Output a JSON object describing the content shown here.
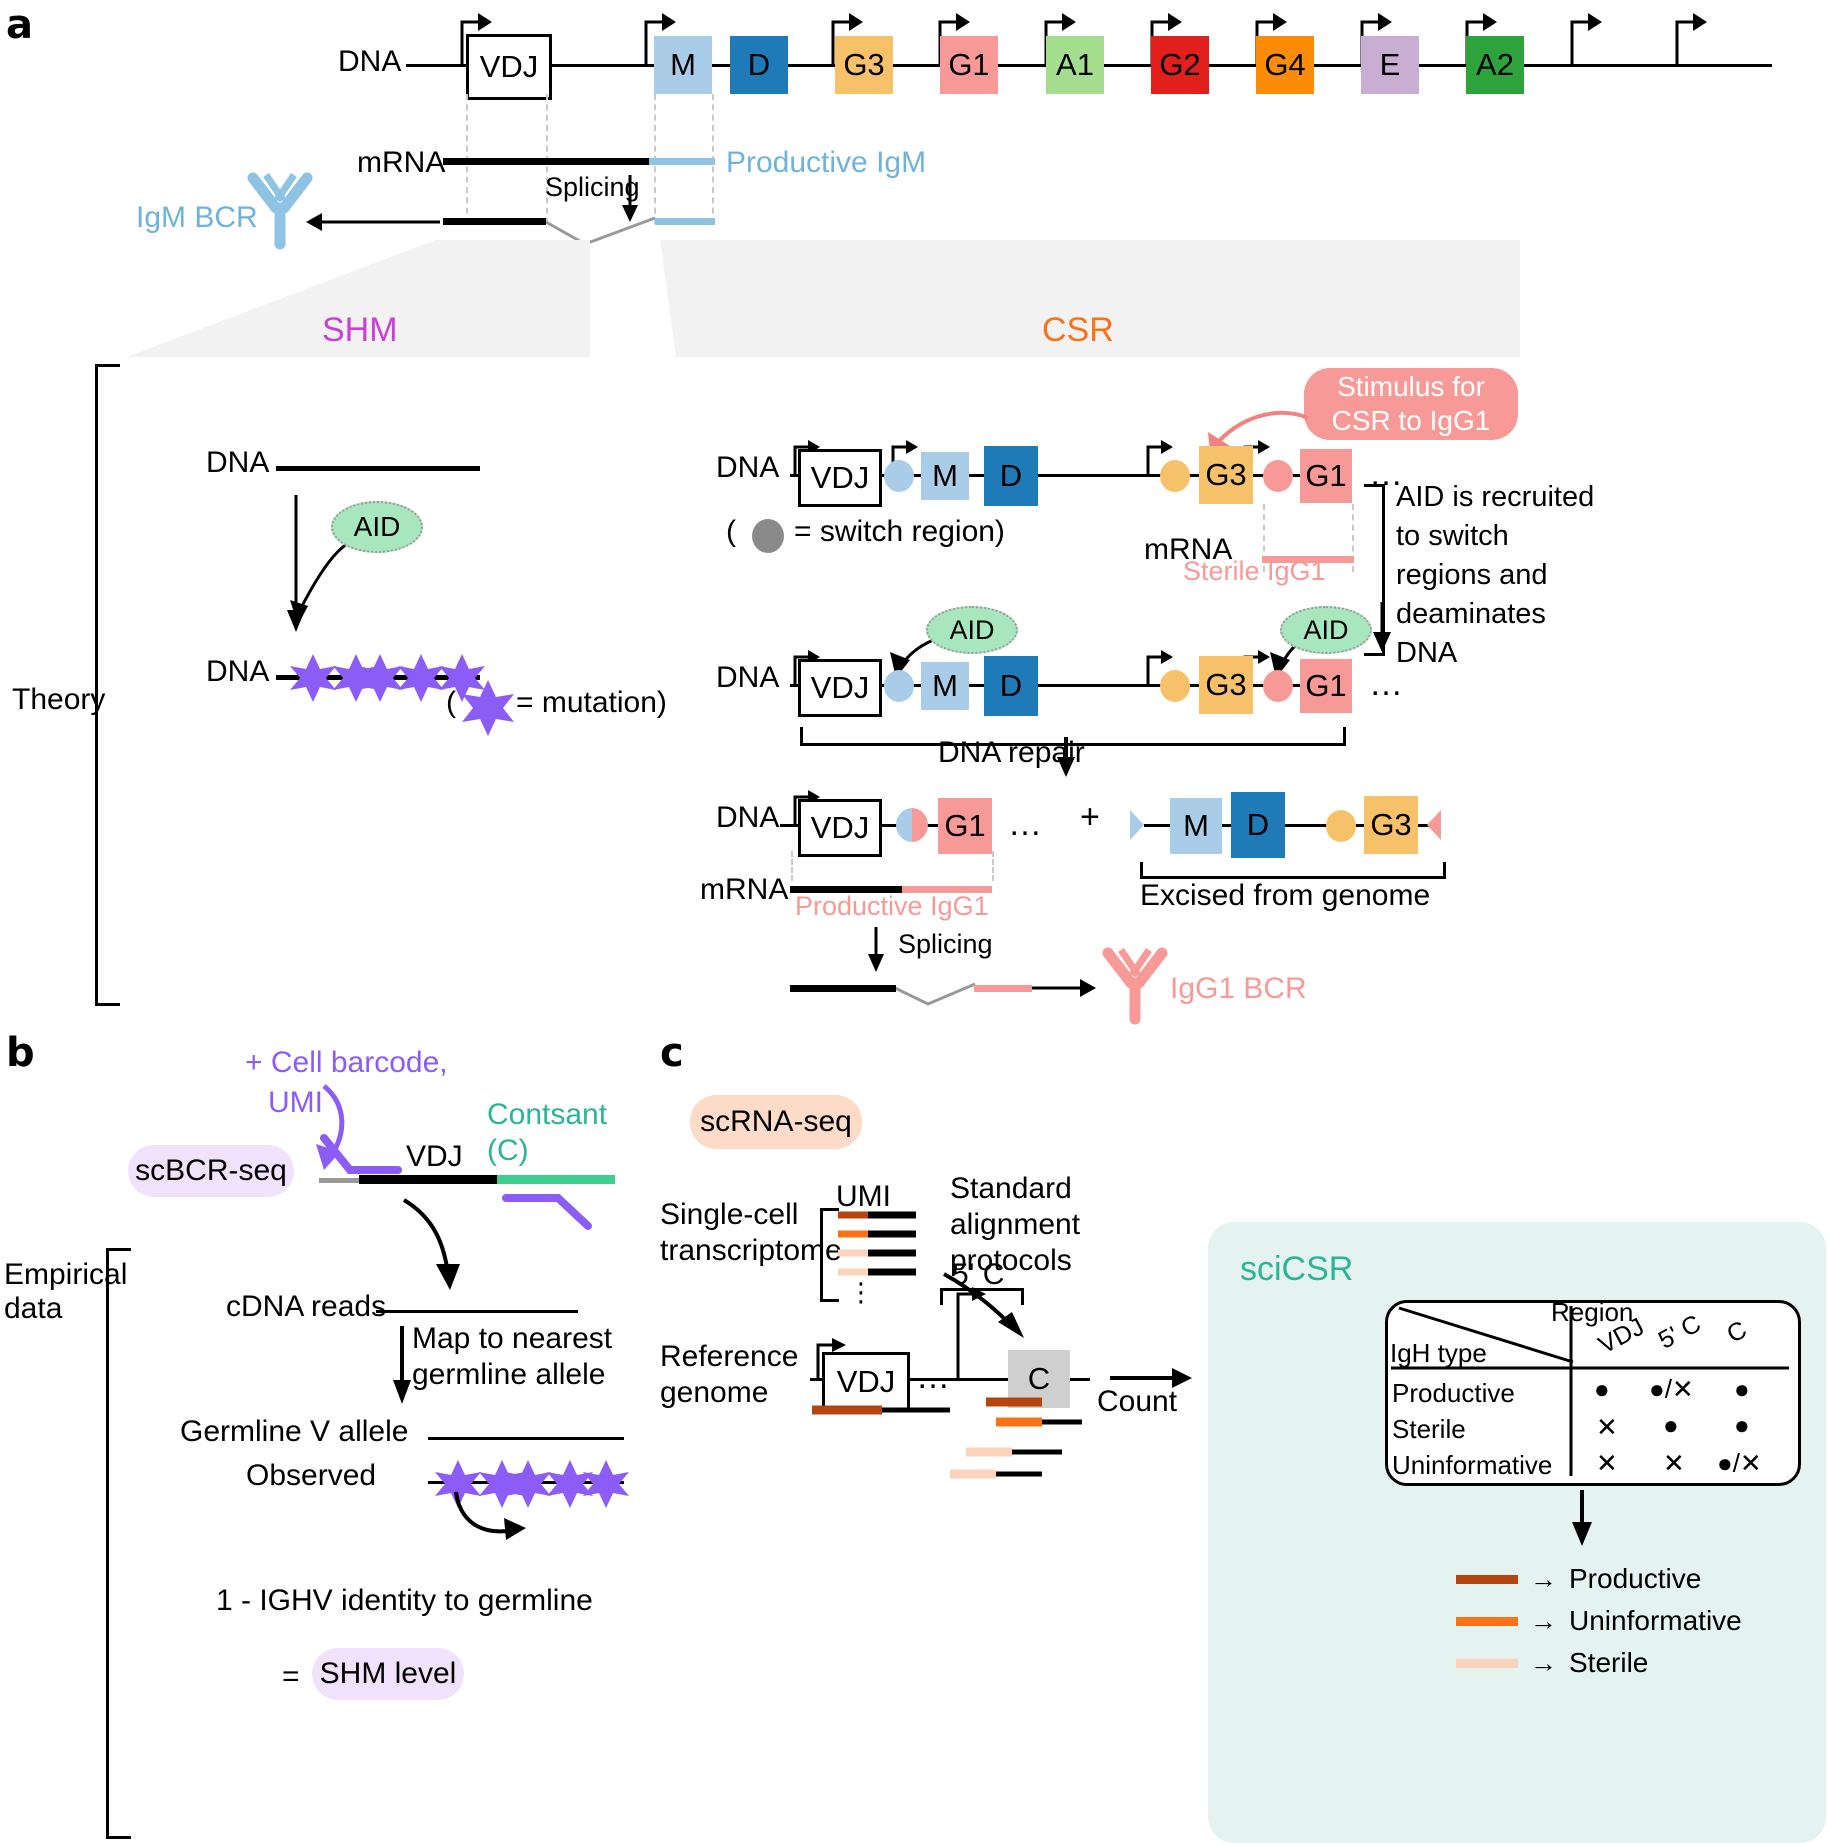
{
  "panels": {
    "a": "a",
    "b": "b",
    "c": "c"
  },
  "side_labels": {
    "theory": "Theory",
    "empirical": "Empirical\ndata",
    "empirical_line1": "Empirical",
    "empirical_line2": "data"
  },
  "colors": {
    "M": "#a9cde8",
    "D": "#1f7ab8",
    "G3": "#f7c169",
    "G1": "#f79a97",
    "A1": "#a5dd8e",
    "G2": "#e31f1c",
    "G4": "#fb8c08",
    "E": "#c8aed2",
    "A2": "#2ea33c",
    "igm_blue": "#8fc3e3",
    "igg1_pink": "#f79a97",
    "shm_purple": "#8b52d6",
    "star_purple": "#8b5cf6",
    "csr_orange": "#f97316",
    "aid_green": "#a8e6bd",
    "switch_gray": "#8a8a8a",
    "teal": "#2bb596",
    "lavender": "#f0e2fb",
    "peach": "#fcdcc8",
    "mint": "#e4f3ef",
    "read_productive": "#b5450f",
    "read_uninformative": "#f97316",
    "read_sterile": "#fbd2bc"
  },
  "a": {
    "dna_label": "DNA",
    "genes": [
      "M",
      "D",
      "G3",
      "G1",
      "A1",
      "G2",
      "G4",
      "E",
      "A2"
    ],
    "vdj": "VDJ",
    "mrna_label": "mRNA",
    "productive_igm": "Productive IgM",
    "splicing": "Splicing",
    "igm_bcr": "IgM BCR",
    "shm_title": "SHM",
    "csr_title": "CSR"
  },
  "shm": {
    "dna_label": "DNA",
    "aid": "AID",
    "mutation_legend": "= mutation)",
    "paren_open": "("
  },
  "csr": {
    "dna_label": "DNA",
    "vdj": "VDJ",
    "mrna_label": "mRNA",
    "row1_genes": [
      "M",
      "D",
      "G3",
      "G1"
    ],
    "switch_legend_open": "(",
    "switch_legend": "= switch region)",
    "stimulus": "Stimulus for\nCSR to IgG1",
    "stimulus_l1": "Stimulus for",
    "stimulus_l2": "CSR to IgG1",
    "sterile_igg1": "Sterile IgG1",
    "aid_note": "AID is recruited\nto switch\nregions and\ndeaminates\nDNA",
    "aid_note_lines": [
      "AID is recruited",
      "to switch",
      "regions and",
      "deaminates",
      "DNA"
    ],
    "aid": "AID",
    "dna_repair": "DNA repair",
    "excised": "Excised from genome",
    "productive_igg1": "Productive IgG1",
    "splicing": "Splicing",
    "igg1_bcr": "IgG1 BCR",
    "plus": "+",
    "ellipsis": "…"
  },
  "b": {
    "badge": "scBCR-seq",
    "cell_barcode_l1": "+ Cell barcode,",
    "cell_barcode_l2": "UMI",
    "constant_l1": "Contsant",
    "constant_l2": "(C)",
    "vdj": "VDJ",
    "cdna_reads": "cDNA reads",
    "map_l1": "Map to nearest",
    "map_l2": "germline allele",
    "germline_v": "Germline V allele",
    "observed": "Observed",
    "identity": "1 - IGHV identity to germline",
    "equals": "=",
    "shm_level": "SHM level"
  },
  "c": {
    "badge": "scRNA-seq",
    "single_cell_l1": "Single-cell",
    "single_cell_l2": "transcriptome",
    "umi": "UMI",
    "standard_l1": "Standard",
    "standard_l2": "alignment",
    "standard_l3": "protocols",
    "reference_l1": "Reference",
    "reference_l2": "genome",
    "vdj": "VDJ",
    "ellipsis": "…",
    "c_box": "C",
    "five_prime_c": "5' C",
    "count": "Count",
    "scicsr": "sciCSR",
    "table": {
      "corner_top": "Region",
      "corner_bottom": "IgH type",
      "columns": [
        "VDJ",
        "5' C",
        "C"
      ],
      "rows": [
        {
          "label": "Productive",
          "cells": [
            "●",
            "●/✕",
            "●"
          ]
        },
        {
          "label": "Sterile",
          "cells": [
            "✕",
            "●",
            "●"
          ]
        },
        {
          "label": "Uninformative",
          "cells": [
            "✕",
            "✕",
            "●/✕"
          ]
        }
      ]
    },
    "legend": [
      {
        "label": "Productive",
        "color": "#b5450f"
      },
      {
        "label": "Uninformative",
        "color": "#f97316"
      },
      {
        "label": "Sterile",
        "color": "#fbd2bc"
      }
    ],
    "legend_arrow": "→"
  }
}
